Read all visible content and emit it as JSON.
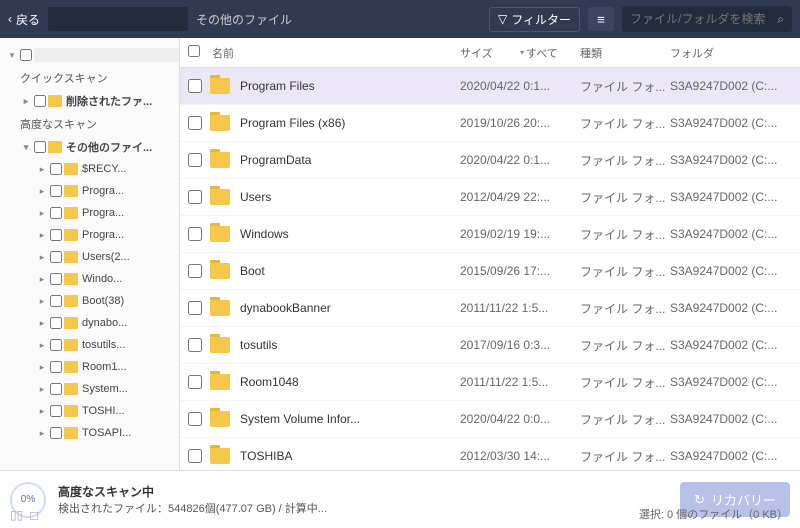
{
  "header": {
    "back_label": "戻る",
    "path": "",
    "path_text": "その他のファイル",
    "filter_label": "フィルター",
    "search_placeholder": "ファイル/フォルダを検索"
  },
  "sidebar": {
    "quick_scan_label": "クイックスキャン",
    "deleted_files_label": "削除されたファ...",
    "advanced_scan_label": "高度なスキャン",
    "other_files_label": "その他のファイ...",
    "tree_items": [
      {
        "label": "$RECY..."
      },
      {
        "label": "Progra..."
      },
      {
        "label": "Progra..."
      },
      {
        "label": "Progra..."
      },
      {
        "label": "Users(2..."
      },
      {
        "label": "Windo..."
      },
      {
        "label": "Boot(38)"
      },
      {
        "label": "dynabo..."
      },
      {
        "label": "tosutils..."
      },
      {
        "label": "Room1..."
      },
      {
        "label": "System..."
      },
      {
        "label": "TOSHI..."
      },
      {
        "label": "TOSAPI..."
      }
    ]
  },
  "columns": {
    "name": "名前",
    "size": "サイズ",
    "all": "すべて",
    "type": "種類",
    "folder": "フォルダ"
  },
  "files": [
    {
      "name": "Program Files",
      "date": "2020/04/22 0:1...",
      "type": "ファイル フォ...",
      "folder": "S3A9247D002 (C:...",
      "selected": true
    },
    {
      "name": "Program Files (x86)",
      "date": "2019/10/26 20:...",
      "type": "ファイル フォ...",
      "folder": "S3A9247D002 (C:...",
      "selected": false
    },
    {
      "name": "ProgramData",
      "date": "2020/04/22 0:1...",
      "type": "ファイル フォ...",
      "folder": "S3A9247D002 (C:...",
      "selected": false
    },
    {
      "name": "Users",
      "date": "2012/04/29 22:...",
      "type": "ファイル フォ...",
      "folder": "S3A9247D002 (C:...",
      "selected": false
    },
    {
      "name": "Windows",
      "date": "2019/02/19 19:...",
      "type": "ファイル フォ...",
      "folder": "S3A9247D002 (C:...",
      "selected": false
    },
    {
      "name": "Boot",
      "date": "2015/09/26 17:...",
      "type": "ファイル フォ...",
      "folder": "S3A9247D002 (C:...",
      "selected": false
    },
    {
      "name": "dynabookBanner",
      "date": "2011/11/22 1:5...",
      "type": "ファイル フォ...",
      "folder": "S3A9247D002 (C:...",
      "selected": false
    },
    {
      "name": "tosutils",
      "date": "2017/09/16 0:3...",
      "type": "ファイル フォ...",
      "folder": "S3A9247D002 (C:...",
      "selected": false
    },
    {
      "name": "Room1048",
      "date": "2011/11/22 1:5...",
      "type": "ファイル フォ...",
      "folder": "S3A9247D002 (C:...",
      "selected": false
    },
    {
      "name": "System Volume Infor...",
      "date": "2020/04/22 0:0...",
      "type": "ファイル フォ...",
      "folder": "S3A9247D002 (C:...",
      "selected": false
    },
    {
      "name": "TOSHIBA",
      "date": "2012/03/30 14:...",
      "type": "ファイル フォ...",
      "folder": "S3A9247D002 (C:...",
      "selected": false
    }
  ],
  "footer": {
    "progress_pct": "0%",
    "scan_title": "高度なスキャン中",
    "scan_details": "検出されたファイル：544826個(477.07 GB) / 計算中...",
    "recover_label": "リカバリー",
    "selection_info": "選択: 0 個のファイル（0 KB）"
  }
}
